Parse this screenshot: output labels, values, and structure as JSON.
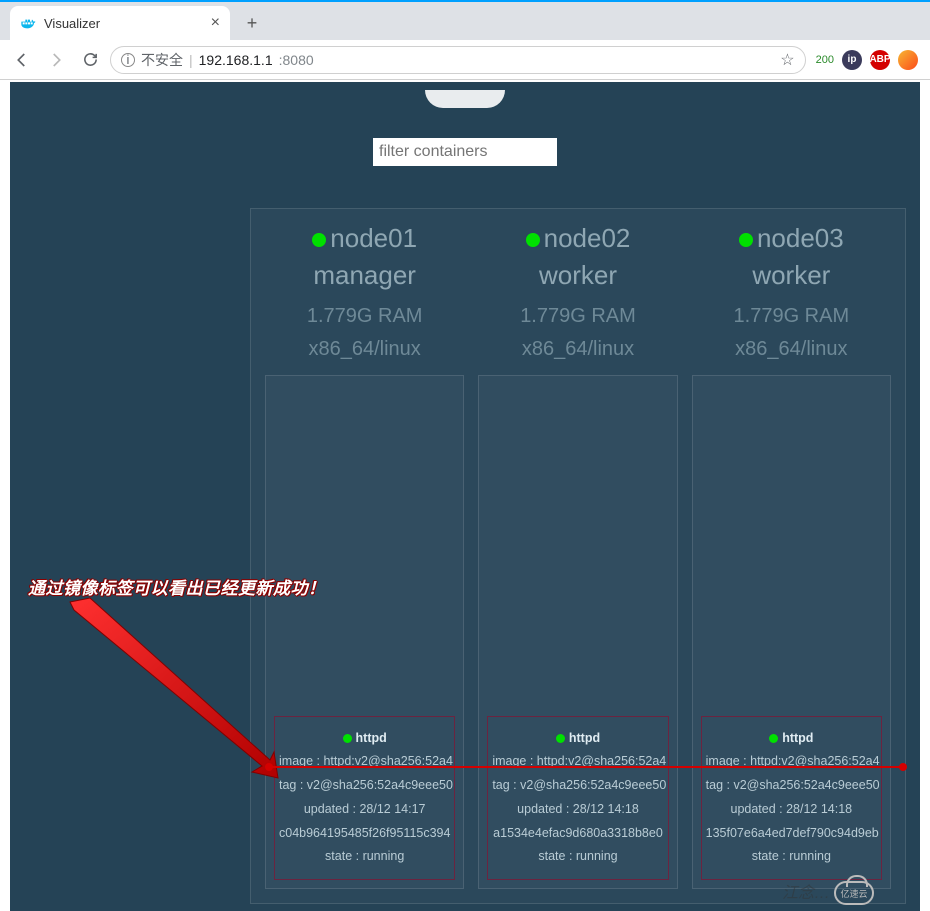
{
  "browser": {
    "tab_title": "Visualizer",
    "url_insecure_label": "不安全",
    "url_host": "192.168.1.1",
    "url_port": ":8080",
    "ext_badge": "200"
  },
  "page": {
    "filter_placeholder": "filter containers"
  },
  "nodes": [
    {
      "name": "node01",
      "role": "manager",
      "ram": "1.779G RAM",
      "arch": "x86_64/linux",
      "task": {
        "service": "httpd",
        "image": "image : httpd:v2@sha256:52a4",
        "tag": "tag : v2@sha256:52a4c9eee50",
        "updated": "updated : 28/12 14:17",
        "id": "c04b964195485f26f95115c394",
        "state": "state : running"
      }
    },
    {
      "name": "node02",
      "role": "worker",
      "ram": "1.779G RAM",
      "arch": "x86_64/linux",
      "task": {
        "service": "httpd",
        "image": "image : httpd:v2@sha256:52a4",
        "tag": "tag : v2@sha256:52a4c9eee50",
        "updated": "updated : 28/12 14:18",
        "id": "a1534e4efac9d680a3318b8e0",
        "state": "state : running"
      }
    },
    {
      "name": "node03",
      "role": "worker",
      "ram": "1.779G RAM",
      "arch": "x86_64/linux",
      "task": {
        "service": "httpd",
        "image": "image : httpd:v2@sha256:52a4",
        "tag": "tag : v2@sha256:52a4c9eee50",
        "updated": "updated : 28/12 14:18",
        "id": "135f07e6a4ed7def790c94d9eb",
        "state": "state : running"
      }
    }
  ],
  "annotation": {
    "text": "通过镜像标签可以看出已经更新成功！"
  },
  "watermark": {
    "text": "江念…",
    "brand": "亿速云"
  }
}
